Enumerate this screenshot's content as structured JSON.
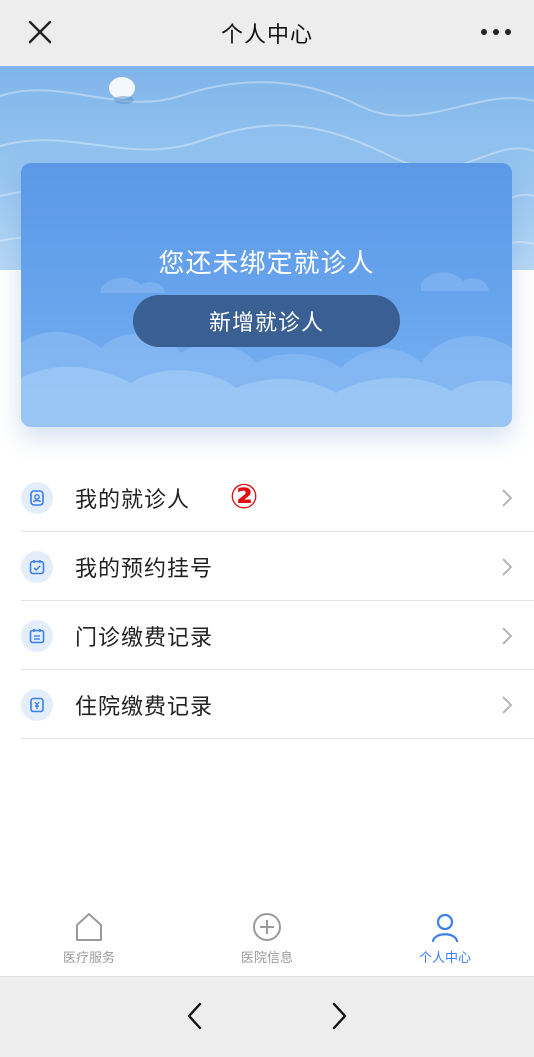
{
  "header": {
    "title": "个人中心",
    "close_icon": "close-icon",
    "more_icon": "more-icon"
  },
  "card": {
    "headline": "您还未绑定就诊人",
    "add_button": "新增就诊人"
  },
  "menu": {
    "items": [
      {
        "label": "我的就诊人",
        "icon": "patient-icon",
        "badge": "②"
      },
      {
        "label": "我的预约挂号",
        "icon": "appointment-icon"
      },
      {
        "label": "门诊缴费记录",
        "icon": "outpatient-bill-icon"
      },
      {
        "label": "住院缴费记录",
        "icon": "inpatient-bill-icon"
      }
    ]
  },
  "tabbar": {
    "tabs": [
      {
        "label": "医疗服务",
        "icon": "home-icon",
        "active": false
      },
      {
        "label": "医院信息",
        "icon": "hospital-plus-icon",
        "active": false
      },
      {
        "label": "个人中心",
        "icon": "user-icon",
        "active": true
      }
    ]
  },
  "colors": {
    "accent": "#3b7ef0",
    "card_button": "#3a5f92",
    "badge": "#e01010"
  }
}
